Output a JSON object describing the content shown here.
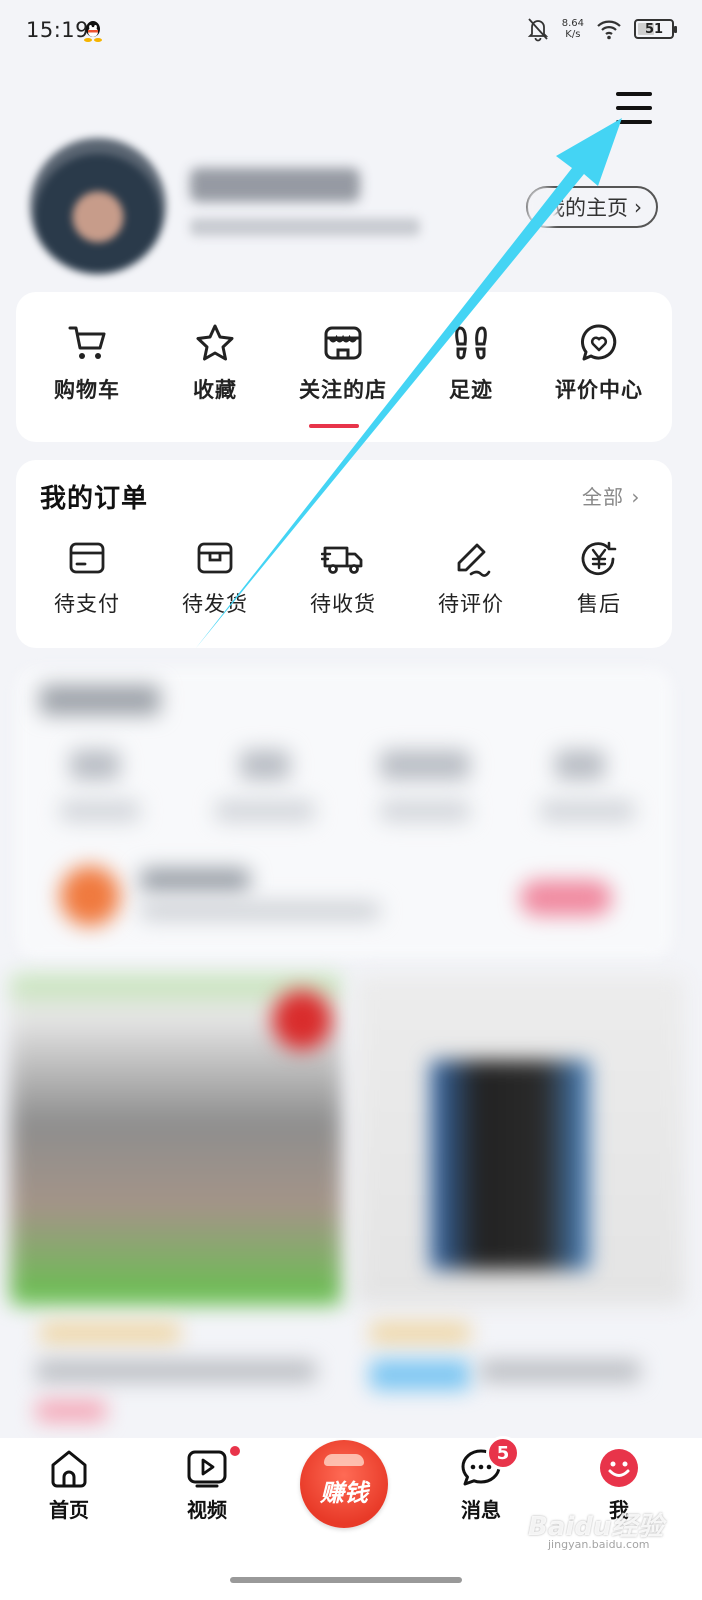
{
  "status_bar": {
    "time": "15:19",
    "net_speed_value": "8.64",
    "net_speed_unit": "K/s",
    "battery": "51",
    "battery_level": 0.51
  },
  "profile": {
    "homepage_button": "我的主页"
  },
  "quick_menu": {
    "items": [
      {
        "label": "购物车",
        "icon": "cart-icon"
      },
      {
        "label": "收藏",
        "icon": "star-icon"
      },
      {
        "label": "关注的店",
        "icon": "store-icon"
      },
      {
        "label": "足迹",
        "icon": "footprint-icon"
      },
      {
        "label": "评价中心",
        "icon": "review-heart-icon"
      }
    ],
    "active_index": 2
  },
  "orders": {
    "title": "我的订单",
    "all_label": "全部",
    "items": [
      {
        "label": "待支付",
        "icon": "card-icon"
      },
      {
        "label": "待发货",
        "icon": "box-icon"
      },
      {
        "label": "待收货",
        "icon": "truck-icon"
      },
      {
        "label": "待评价",
        "icon": "pen-icon"
      },
      {
        "label": "售后",
        "icon": "yuan-refund-icon"
      }
    ]
  },
  "bottom_nav": {
    "items": [
      {
        "label": "首页",
        "icon": "home-icon"
      },
      {
        "label": "视频",
        "icon": "video-icon"
      },
      {
        "label": "赚钱",
        "icon": "earn-icon"
      },
      {
        "label": "消息",
        "icon": "message-icon",
        "badge": "5"
      },
      {
        "label": "我",
        "icon": "me-icon"
      }
    ]
  },
  "watermark": {
    "text": "Baidu经验",
    "sub": "jingyan.baidu.com"
  },
  "colors": {
    "accent": "#e8344a",
    "annotation_arrow": "#44d4f4",
    "background": "#f3f4f8"
  }
}
